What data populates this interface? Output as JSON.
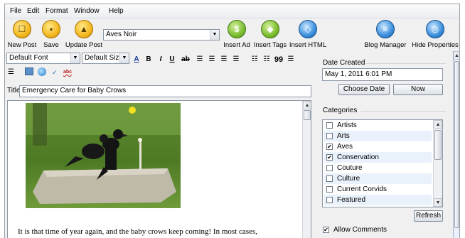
{
  "menu": [
    "File",
    "Edit",
    "Format",
    "Window",
    "Help"
  ],
  "toolbar": {
    "new_post": "New Post",
    "save": "Save",
    "update_post": "Update Post",
    "blog_select": "Aves Noir",
    "insert_ad": "Insert Ad",
    "insert_tags": "Insert Tags",
    "insert_html": "Insert HTML",
    "blog_manager": "Blog Manager",
    "hide_properties": "Hide Properties"
  },
  "format": {
    "font": "Default Font",
    "size": "Default Size",
    "buttons": [
      "A",
      "B",
      "I",
      "U",
      "ab",
      "99"
    ]
  },
  "title": {
    "label": "Title",
    "value": "Emergency Care for Baby Crows"
  },
  "editor": {
    "body_text": "It is that time of year again, and the baby crows keep coming! In most cases,"
  },
  "properties": {
    "date_label": "Date Created",
    "date_value": "May 1, 2011 6:01 PM",
    "choose_date": "Choose Date",
    "now": "Now",
    "categories_label": "Categories",
    "categories": [
      {
        "label": "Artists",
        "checked": false
      },
      {
        "label": "Arts",
        "checked": false
      },
      {
        "label": "Aves",
        "checked": true
      },
      {
        "label": "Conservation",
        "checked": true
      },
      {
        "label": "Couture",
        "checked": false
      },
      {
        "label": "Culture",
        "checked": false
      },
      {
        "label": "Current Corvids",
        "checked": false
      },
      {
        "label": "Featured",
        "checked": false
      }
    ],
    "refresh": "Refresh",
    "allow_comments": "Allow Comments",
    "allow_comments_checked": true
  },
  "icons": {
    "new_post": "new-post-icon",
    "save": "save-icon",
    "update_post": "update-post-icon",
    "insert_ad": "insert-ad-icon",
    "insert_tags": "insert-tags-icon",
    "insert_html": "insert-html-icon",
    "blog_manager": "blog-manager-icon",
    "hide_properties": "hide-properties-icon"
  },
  "colors": {
    "gold": "#f3b81e",
    "green": "#7bbd2f",
    "blue": "#3a8fdc",
    "list_alt": "#e9f1fa"
  }
}
